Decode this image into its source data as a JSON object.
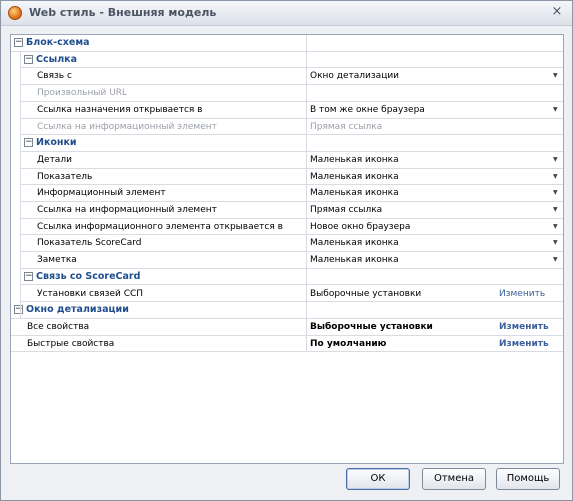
{
  "window": {
    "title": "Web стиль - Внешняя модель",
    "close_glyph": "×"
  },
  "sections": {
    "flowchart": {
      "title": "Блок-схема"
    },
    "link": {
      "title": "Ссылка",
      "rows": [
        {
          "name": "Связь с",
          "value": "Окно детализации",
          "dropdown": true,
          "disabled": false
        },
        {
          "name": "Произвольный URL",
          "value": "",
          "dropdown": false,
          "disabled": true
        },
        {
          "name": "Ссылка назначения открывается в",
          "value": "В том же окне браузера",
          "dropdown": true,
          "disabled": false
        },
        {
          "name": "Ссылка на информационный элемент",
          "value": "Прямая ссылка",
          "dropdown": false,
          "disabled": true
        }
      ]
    },
    "icons": {
      "title": "Иконки",
      "rows": [
        {
          "name": "Детали",
          "value": "Маленькая иконка"
        },
        {
          "name": "Показатель",
          "value": "Маленькая иконка"
        },
        {
          "name": "Информационный элемент",
          "value": "Маленькая иконка"
        },
        {
          "name": "Ссылка на информационный элемент",
          "value": "Прямая ссылка"
        },
        {
          "name": "Ссылка информационного элемента открывается в",
          "value": "Новое окно браузера"
        },
        {
          "name": "Показатель ScoreCard",
          "value": "Маленькая иконка"
        },
        {
          "name": "Заметка",
          "value": "Маленькая иконка"
        }
      ]
    },
    "scorecard": {
      "title": "Связь со ScoreCard",
      "rows": [
        {
          "name": "Установки связей ССП",
          "value": "Выборочные установки",
          "action": "Изменить"
        }
      ]
    },
    "detail": {
      "title": "Окно детализации",
      "rows": [
        {
          "name": "Все свойства",
          "value": "Выборочные установки",
          "action": "Изменить"
        },
        {
          "name": "Быстрые свойства",
          "value": "По умолчанию",
          "action": "Изменить"
        }
      ]
    }
  },
  "buttons": {
    "ok": "ОК",
    "cancel": "Отмена",
    "help": "Помощь"
  },
  "icons": {
    "expander": "minus-box",
    "dropdown": "triangle-down"
  }
}
